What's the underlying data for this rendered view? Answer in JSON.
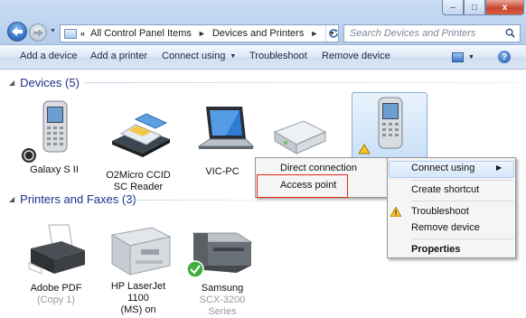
{
  "window": {
    "controls": {
      "minimize": "–",
      "maximize": "□",
      "close": "x"
    }
  },
  "navigation": {
    "back_icon": "arrow-left-icon",
    "forward_icon": "arrow-right-icon",
    "breadcrumbs": [
      "All Control Panel Items",
      "Devices and Printers"
    ],
    "search_placeholder": "Search Devices and Printers"
  },
  "toolbar": {
    "items": [
      "Add a device",
      "Add a printer",
      "Connect using",
      "Troubleshoot",
      "Remove device"
    ],
    "view_icon": "view-options-icon",
    "help_label": "?"
  },
  "groups": {
    "devices": {
      "title": "Devices (5)",
      "items": [
        {
          "label": "Galaxy S II",
          "icon": "phone-icon"
        },
        {
          "label": "O2Micro CCID SC Reader",
          "icon": "card-reader-icon"
        },
        {
          "label": "VIC-PC",
          "icon": "laptop-icon"
        },
        {
          "label": "",
          "icon": "hard-drive-icon"
        },
        {
          "label": "",
          "icon": "phone-icon"
        }
      ]
    },
    "printers": {
      "title": "Printers and Faxes (3)",
      "items": [
        {
          "label_line1": "Adobe PDF",
          "label_line2": "(Copy 1)"
        },
        {
          "label_line1": "HP LaserJet 1100",
          "label_line2": "(MS) on"
        },
        {
          "label_line1": "Samsung",
          "label_line2": "SCX-3200 Series"
        }
      ]
    }
  },
  "context_menu": {
    "items": [
      "Connect using",
      "Create shortcut",
      "Troubleshoot",
      "Remove device",
      "Properties"
    ]
  },
  "submenu": {
    "items": [
      "Direct connection",
      "Access point"
    ]
  },
  "colors": {
    "group_title": "#1e3287",
    "highlight_box": "#e0251c",
    "selection": "#c9e0f8"
  }
}
